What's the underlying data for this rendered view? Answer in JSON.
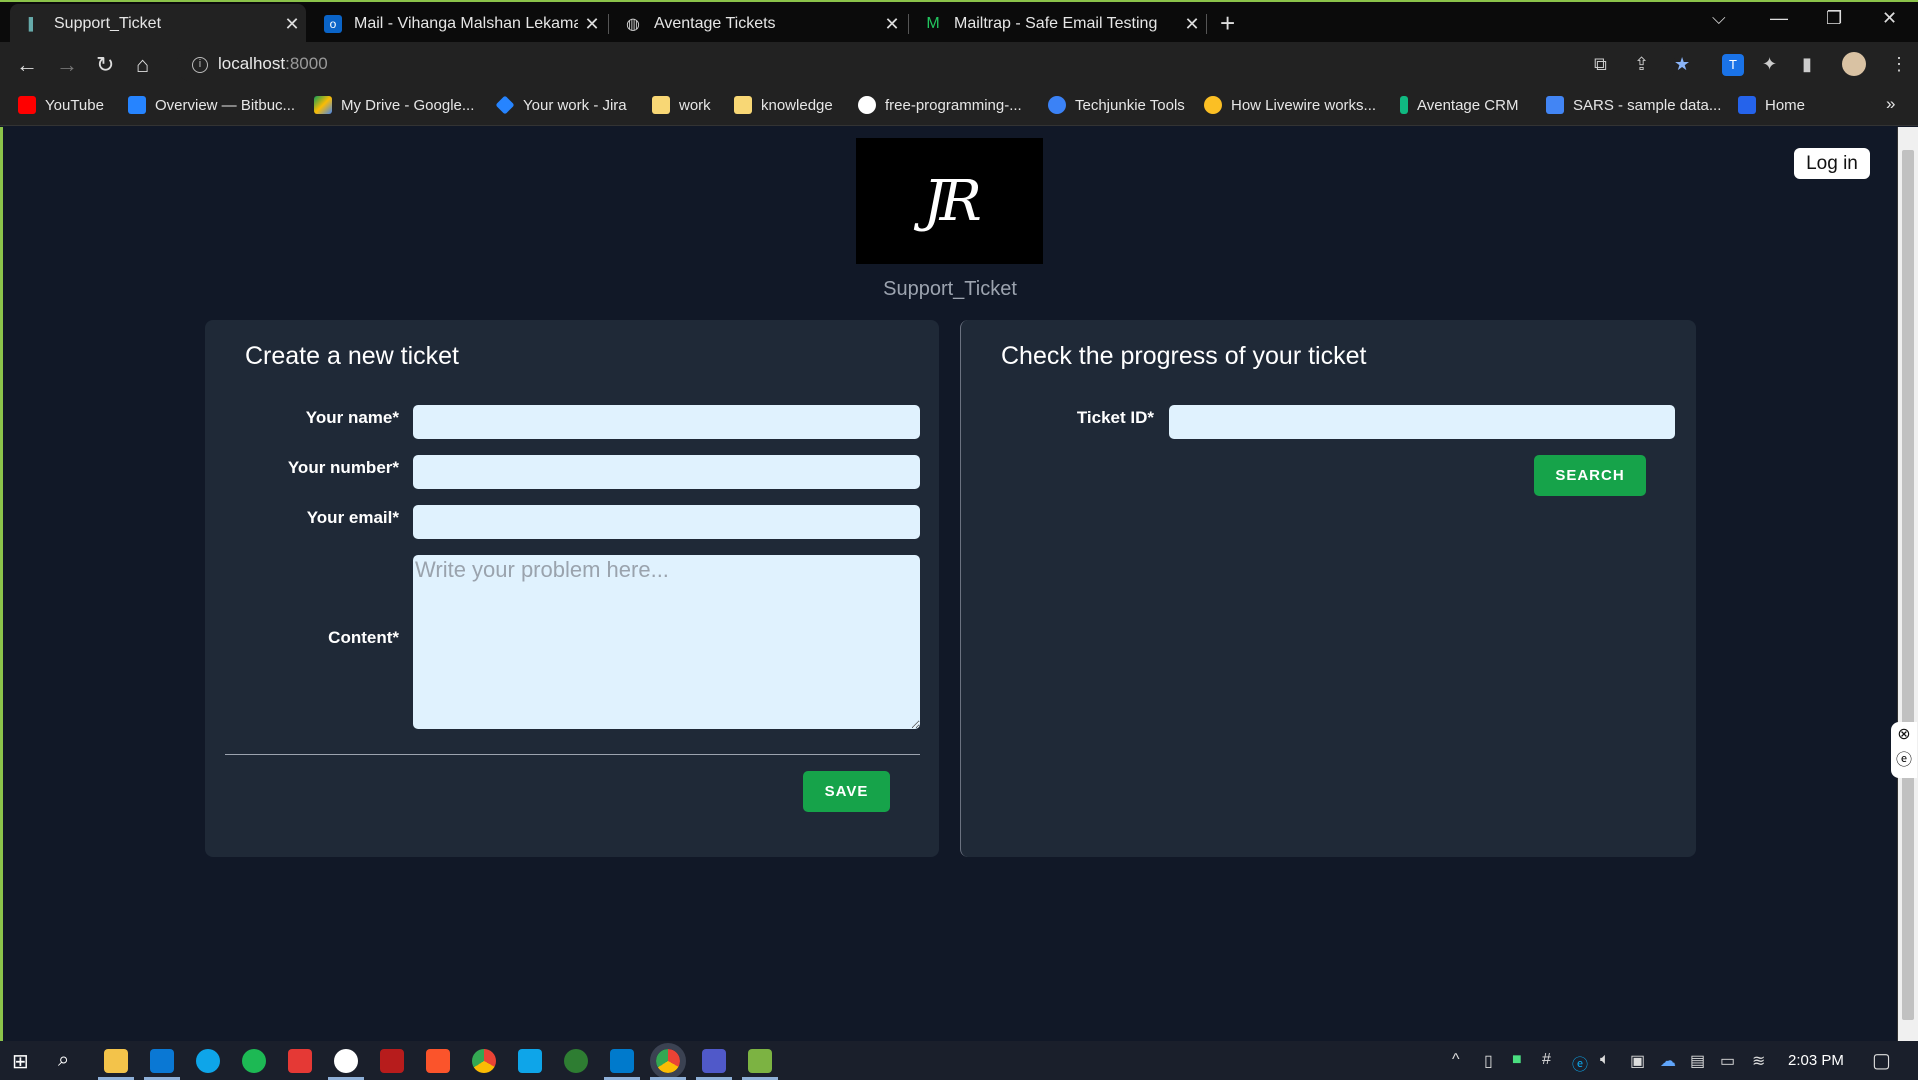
{
  "browser": {
    "tabs": [
      {
        "label": "Support_Ticket",
        "active": true,
        "icon": "support-favicon"
      },
      {
        "label": "Mail - Vihanga Malshan Lekamal",
        "active": false,
        "icon": "outlook-icon"
      },
      {
        "label": "Aventage Tickets",
        "active": false,
        "icon": "globe-icon"
      },
      {
        "label": "Mailtrap - Safe Email Testing",
        "active": false,
        "icon": "mailtrap-icon"
      }
    ],
    "url_host": "localhost",
    "url_port": ":8000",
    "bookmarks": [
      {
        "label": "YouTube",
        "color": "#ff0000"
      },
      {
        "label": "Overview — Bitbuc...",
        "color": "#2684ff"
      },
      {
        "label": "My Drive - Google...",
        "color": "#fbbc04"
      },
      {
        "label": "Your work - Jira",
        "color": "#2684ff"
      },
      {
        "label": "work",
        "color": "#f8d775"
      },
      {
        "label": "knowledge",
        "color": "#f8d775"
      },
      {
        "label": "free-programming-...",
        "color": "#ffffff"
      },
      {
        "label": "Techjunkie Tools",
        "color": "#3b82f6"
      },
      {
        "label": "How Livewire works...",
        "color": "#fbbf24"
      },
      {
        "label": "Aventage CRM",
        "color": "#10b981"
      },
      {
        "label": "SARS - sample data...",
        "color": "#4285f4"
      },
      {
        "label": "Home",
        "color": "#2563eb"
      }
    ]
  },
  "header": {
    "logo_text": "JR",
    "site_name": "Support_Ticket",
    "login_label": "Log in"
  },
  "create_ticket": {
    "title": "Create a new ticket",
    "name_label": "Your name*",
    "number_label": "Your number*",
    "email_label": "Your email*",
    "content_label": "Content*",
    "content_placeholder": "Write your problem here...",
    "save_label": "SAVE"
  },
  "check_ticket": {
    "title": "Check the progress of your ticket",
    "ticket_id_label": "Ticket ID*",
    "search_label": "SEARCH"
  },
  "taskbar": {
    "time": "2:03 PM"
  },
  "colors": {
    "page_bg": "#111827",
    "card_bg": "#1f2937",
    "input_bg": "#e0f2fe",
    "button_green": "#16a34a"
  }
}
